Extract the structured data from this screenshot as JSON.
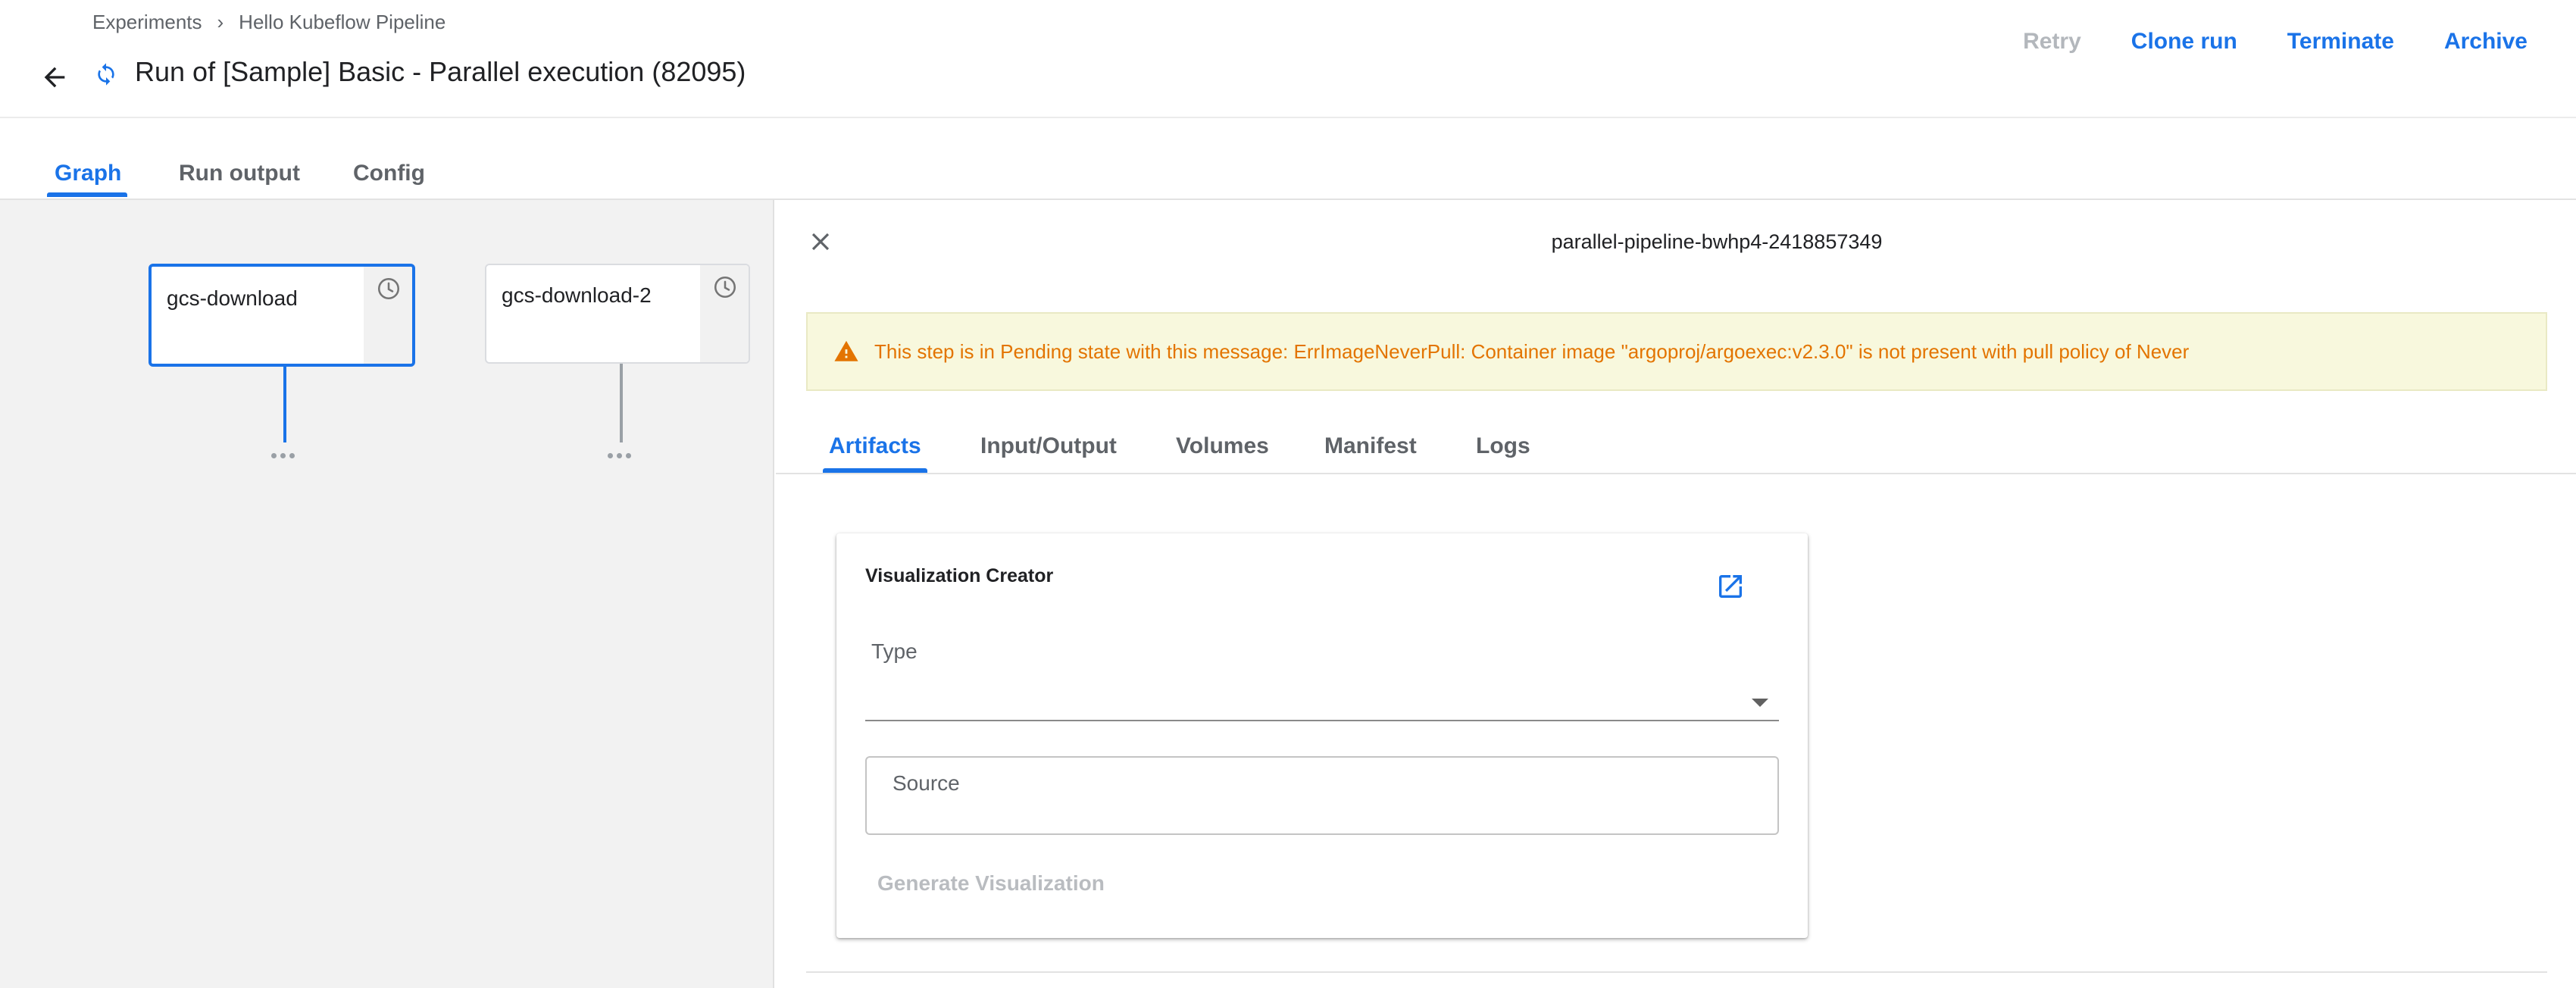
{
  "breadcrumb": {
    "items": [
      "Experiments",
      "Hello Kubeflow Pipeline"
    ],
    "separator": "›"
  },
  "header": {
    "title": "Run of [Sample] Basic - Parallel execution (82095)",
    "status_icon": "running-sync-icon"
  },
  "actions": {
    "retry": "Retry",
    "clone_run": "Clone run",
    "terminate": "Terminate",
    "archive": "Archive"
  },
  "tabs": [
    {
      "label": "Graph",
      "active": true
    },
    {
      "label": "Run output",
      "active": false
    },
    {
      "label": "Config",
      "active": false
    }
  ],
  "graph": {
    "nodes": [
      {
        "label": "gcs-download",
        "selected": true,
        "status_icon": "clock-icon"
      },
      {
        "label": "gcs-download-2",
        "selected": false,
        "status_icon": "clock-icon"
      }
    ]
  },
  "side_panel": {
    "node_id": "parallel-pipeline-bwhp4-2418857349",
    "warning": "This step is in Pending state with this message: ErrImageNeverPull: Container image \"argoproj/argoexec:v2.3.0\" is not present with pull policy of Never",
    "tabs": [
      {
        "label": "Artifacts",
        "active": true
      },
      {
        "label": "Input/Output",
        "active": false
      },
      {
        "label": "Volumes",
        "active": false
      },
      {
        "label": "Manifest",
        "active": false
      },
      {
        "label": "Logs",
        "active": false
      }
    ],
    "viz": {
      "title": "Visualization Creator",
      "type_label": "Type",
      "type_value": "",
      "source_placeholder": "Source",
      "generate_label": "Generate Visualization"
    }
  },
  "colors": {
    "accent": "#1a73e8",
    "warning_text": "#e37400",
    "warning_bg": "#f8f8dd",
    "disabled": "#b3b7bc"
  }
}
